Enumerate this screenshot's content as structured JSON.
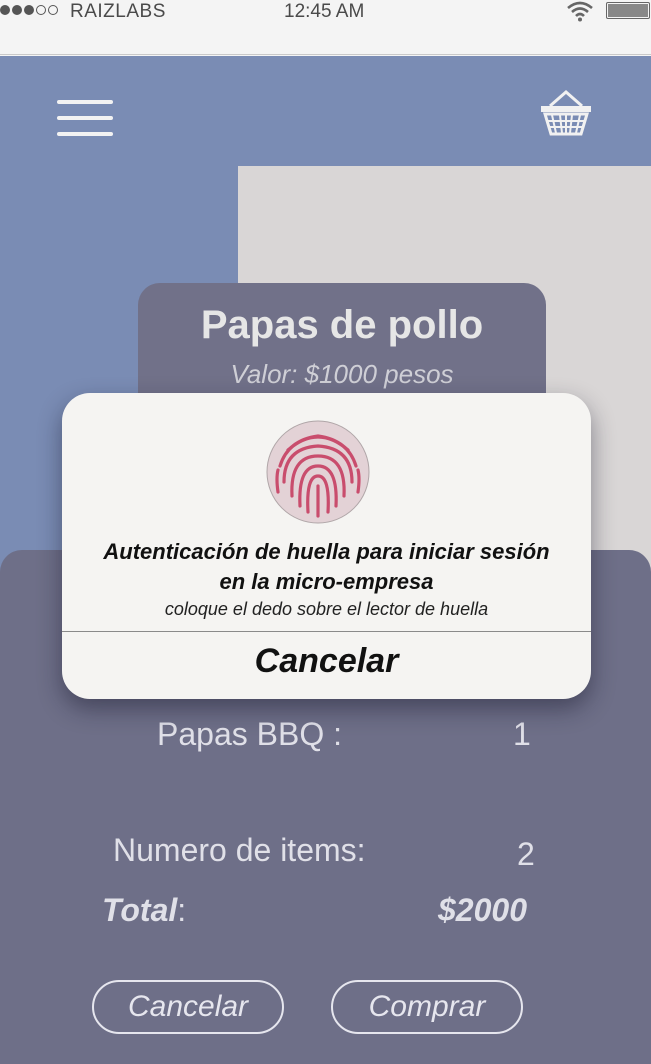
{
  "statusbar": {
    "carrier": "RAIZLABS",
    "time": "12:45 AM",
    "signal_icon": "signal-dots-icon",
    "wifi_icon": "wifi-icon",
    "battery_icon": "battery-icon"
  },
  "header": {
    "menu_icon": "hamburger-menu-icon",
    "cart_icon": "basket-icon"
  },
  "product": {
    "title": "Papas de pollo",
    "price": "Valor: $1000  pesos"
  },
  "order": {
    "item_label": "Papas BBQ :",
    "item_qty": "1",
    "items_label": "Numero de items:",
    "items_count": "2",
    "total_label": "Total",
    "total_colon": ":",
    "total_value": "$2000",
    "cancel_label": "Cancelar",
    "buy_label": "Comprar"
  },
  "dialog": {
    "icon": "fingerprint-icon",
    "title": "Autenticación de huella para iniciar sesión en la micro-empresa",
    "subtitle": "coloque el dedo sobre el lector de huella",
    "cancel_label": "Cancelar"
  },
  "colors": {
    "background_blue": "#7a8cb4",
    "panel": "#6e6f88",
    "card": "#717189",
    "dialog": "#f5f4f2",
    "fingerprint": "#c94d6d"
  }
}
